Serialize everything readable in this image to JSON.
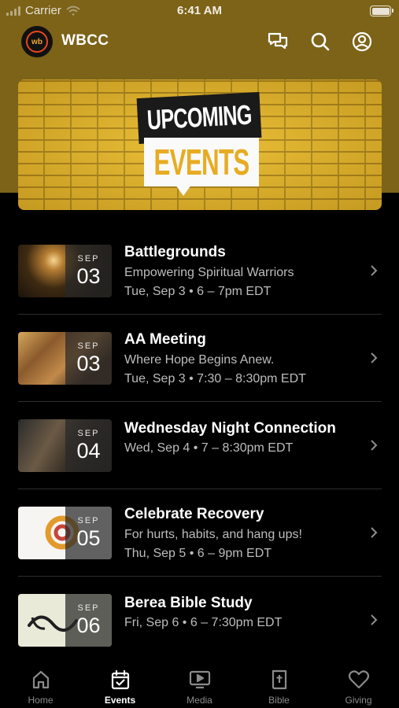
{
  "status_bar": {
    "carrier": "Carrier",
    "time": "6:41 AM",
    "battery_level": 1.0
  },
  "header": {
    "logo_text": "wb",
    "title": "WBCC",
    "icons": [
      "chat-icon",
      "search-icon",
      "profile-icon"
    ]
  },
  "banner": {
    "line1": "UPCOMING",
    "line2": "EVENTS"
  },
  "events": [
    {
      "month": "SEP",
      "day": "03",
      "title": "Battlegrounds",
      "subtitle": "Empowering Spiritual Warriors",
      "time": "Tue, Sep 3 • 6 – 7pm EDT"
    },
    {
      "month": "SEP",
      "day": "03",
      "title": "AA Meeting",
      "subtitle": "Where Hope Begins Anew.",
      "time": "Tue, Sep 3 • 7:30 – 8:30pm EDT"
    },
    {
      "month": "SEP",
      "day": "04",
      "title": "Wednesday Night Connection",
      "subtitle": "",
      "time": "Wed, Sep 4 • 7 – 8:30pm EDT"
    },
    {
      "month": "SEP",
      "day": "05",
      "title": "Celebrate Recovery",
      "subtitle": "For hurts, habits, and hang ups!",
      "time": "Thu, Sep 5 • 6 – 9pm EDT"
    },
    {
      "month": "SEP",
      "day": "06",
      "title": "Berea Bible Study",
      "subtitle": "",
      "time": "Fri, Sep 6 • 6 – 7:30pm EDT"
    }
  ],
  "tab_bar": {
    "active": "Events",
    "tabs": [
      {
        "label": "Home",
        "icon": "home-icon"
      },
      {
        "label": "Events",
        "icon": "calendar-icon"
      },
      {
        "label": "Media",
        "icon": "play-screen-icon"
      },
      {
        "label": "Bible",
        "icon": "bible-icon"
      },
      {
        "label": "Giving",
        "icon": "heart-icon"
      }
    ]
  },
  "colors": {
    "header_background": "#7c6318",
    "banner_brick": "#e8b92c",
    "banner_accent": "#e7ac23",
    "background": "#000000",
    "logo_ring": "#e8471c"
  }
}
